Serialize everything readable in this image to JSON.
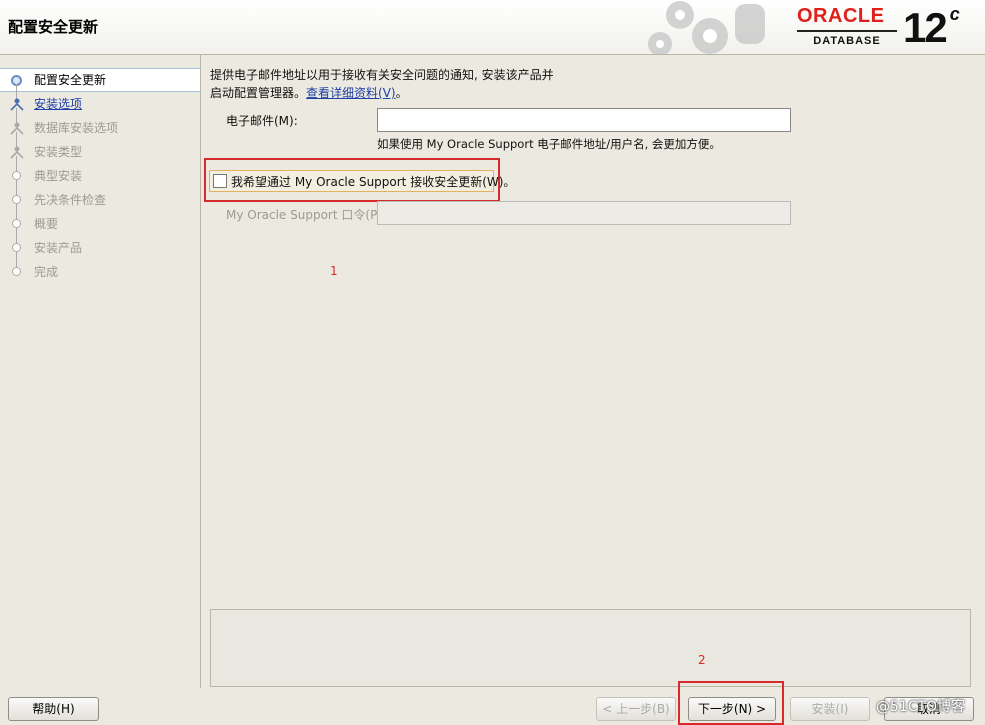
{
  "header": {
    "title": "配置安全更新",
    "brand": "ORACLE",
    "product": "DATABASE",
    "version": "12",
    "version_suffix": "c"
  },
  "steps": [
    {
      "label": "配置安全更新",
      "state": "active"
    },
    {
      "label": "安装选项",
      "state": "link"
    },
    {
      "label": "数据库安装选项",
      "state": "disabled"
    },
    {
      "label": "安装类型",
      "state": "disabled"
    },
    {
      "label": "典型安装",
      "state": "disabled"
    },
    {
      "label": "先决条件检查",
      "state": "disabled"
    },
    {
      "label": "概要",
      "state": "disabled"
    },
    {
      "label": "安装产品",
      "state": "disabled"
    },
    {
      "label": "完成",
      "state": "disabled"
    }
  ],
  "content": {
    "desc_line1": "提供电子邮件地址以用于接收有关安全问题的通知, 安装该产品并",
    "desc_line2_prefix": "启动配置管理器。",
    "details_link": "查看详细资料(V)",
    "desc_line2_suffix": "。",
    "email_label": "电子邮件(M):",
    "email_value": "",
    "email_hint": "如果使用 My Oracle Support 电子邮件地址/用户名, 会更加方便。",
    "checkbox_label": "我希望通过 My Oracle Support 接收安全更新(W)。",
    "checkbox_checked": false,
    "password_label": "My Oracle Support 口令(P):",
    "password_value": "",
    "annotation_1": "1",
    "annotation_2": "2"
  },
  "footer": {
    "help": "帮助(H)",
    "back": "< 上一步(B)",
    "next": "下一步(N) >",
    "install": "安装(I)",
    "cancel": "取消"
  },
  "watermark": "@51CTO博客",
  "colors": {
    "oracle_red": "#e0201b",
    "annotation_red": "#d72b2b",
    "link_blue": "#1d3fa6",
    "background": "#eceae0"
  }
}
